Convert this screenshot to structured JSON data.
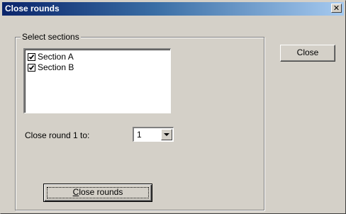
{
  "window": {
    "title": "Close rounds",
    "close_glyph": "✕"
  },
  "group": {
    "label": "Select sections",
    "sections": [
      {
        "label": "Section A",
        "checked": true
      },
      {
        "label": "Section B",
        "checked": true
      }
    ]
  },
  "close_round": {
    "label": "Close round 1 to:",
    "value": "1"
  },
  "buttons": {
    "close": "Close",
    "close_rounds_first": "C",
    "close_rounds_rest": "lose rounds"
  }
}
